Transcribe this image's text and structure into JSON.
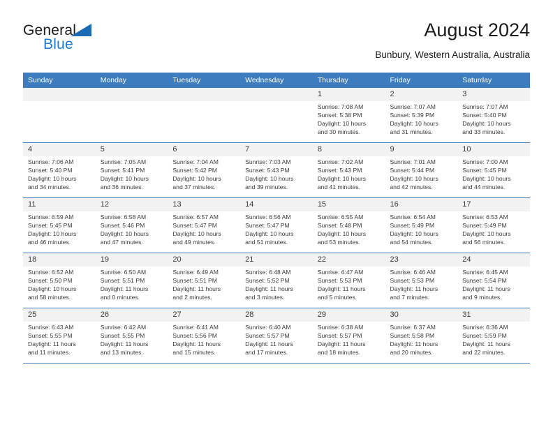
{
  "logo": {
    "word1": "General",
    "word2": "Blue",
    "triangle_color": "#1a6cb5",
    "blue_color": "#1a7cd0"
  },
  "header": {
    "title": "August 2024",
    "subtitle": "Bunbury, Western Australia, Australia",
    "header_bg": "#3c7cbf",
    "daynum_bg": "#f2f2f2"
  },
  "weekday_headers": [
    "Sunday",
    "Monday",
    "Tuesday",
    "Wednesday",
    "Thursday",
    "Friday",
    "Saturday"
  ],
  "labels": {
    "sunrise_prefix": "Sunrise:",
    "sunset_prefix": "Sunset:",
    "daylight_prefix": "Daylight:"
  },
  "weeks": [
    [
      {
        "day": "",
        "empty": true
      },
      {
        "day": "",
        "empty": true
      },
      {
        "day": "",
        "empty": true
      },
      {
        "day": "",
        "empty": true
      },
      {
        "day": "1",
        "sunrise": "Sunrise: 7:08 AM",
        "sunset": "Sunset: 5:38 PM",
        "daylight_l1": "Daylight: 10 hours",
        "daylight_l2": "and 30 minutes."
      },
      {
        "day": "2",
        "sunrise": "Sunrise: 7:07 AM",
        "sunset": "Sunset: 5:39 PM",
        "daylight_l1": "Daylight: 10 hours",
        "daylight_l2": "and 31 minutes."
      },
      {
        "day": "3",
        "sunrise": "Sunrise: 7:07 AM",
        "sunset": "Sunset: 5:40 PM",
        "daylight_l1": "Daylight: 10 hours",
        "daylight_l2": "and 33 minutes."
      }
    ],
    [
      {
        "day": "4",
        "sunrise": "Sunrise: 7:06 AM",
        "sunset": "Sunset: 5:40 PM",
        "daylight_l1": "Daylight: 10 hours",
        "daylight_l2": "and 34 minutes."
      },
      {
        "day": "5",
        "sunrise": "Sunrise: 7:05 AM",
        "sunset": "Sunset: 5:41 PM",
        "daylight_l1": "Daylight: 10 hours",
        "daylight_l2": "and 36 minutes."
      },
      {
        "day": "6",
        "sunrise": "Sunrise: 7:04 AM",
        "sunset": "Sunset: 5:42 PM",
        "daylight_l1": "Daylight: 10 hours",
        "daylight_l2": "and 37 minutes."
      },
      {
        "day": "7",
        "sunrise": "Sunrise: 7:03 AM",
        "sunset": "Sunset: 5:43 PM",
        "daylight_l1": "Daylight: 10 hours",
        "daylight_l2": "and 39 minutes."
      },
      {
        "day": "8",
        "sunrise": "Sunrise: 7:02 AM",
        "sunset": "Sunset: 5:43 PM",
        "daylight_l1": "Daylight: 10 hours",
        "daylight_l2": "and 41 minutes."
      },
      {
        "day": "9",
        "sunrise": "Sunrise: 7:01 AM",
        "sunset": "Sunset: 5:44 PM",
        "daylight_l1": "Daylight: 10 hours",
        "daylight_l2": "and 42 minutes."
      },
      {
        "day": "10",
        "sunrise": "Sunrise: 7:00 AM",
        "sunset": "Sunset: 5:45 PM",
        "daylight_l1": "Daylight: 10 hours",
        "daylight_l2": "and 44 minutes."
      }
    ],
    [
      {
        "day": "11",
        "sunrise": "Sunrise: 6:59 AM",
        "sunset": "Sunset: 5:45 PM",
        "daylight_l1": "Daylight: 10 hours",
        "daylight_l2": "and 46 minutes."
      },
      {
        "day": "12",
        "sunrise": "Sunrise: 6:58 AM",
        "sunset": "Sunset: 5:46 PM",
        "daylight_l1": "Daylight: 10 hours",
        "daylight_l2": "and 47 minutes."
      },
      {
        "day": "13",
        "sunrise": "Sunrise: 6:57 AM",
        "sunset": "Sunset: 5:47 PM",
        "daylight_l1": "Daylight: 10 hours",
        "daylight_l2": "and 49 minutes."
      },
      {
        "day": "14",
        "sunrise": "Sunrise: 6:56 AM",
        "sunset": "Sunset: 5:47 PM",
        "daylight_l1": "Daylight: 10 hours",
        "daylight_l2": "and 51 minutes."
      },
      {
        "day": "15",
        "sunrise": "Sunrise: 6:55 AM",
        "sunset": "Sunset: 5:48 PM",
        "daylight_l1": "Daylight: 10 hours",
        "daylight_l2": "and 53 minutes."
      },
      {
        "day": "16",
        "sunrise": "Sunrise: 6:54 AM",
        "sunset": "Sunset: 5:49 PM",
        "daylight_l1": "Daylight: 10 hours",
        "daylight_l2": "and 54 minutes."
      },
      {
        "day": "17",
        "sunrise": "Sunrise: 6:53 AM",
        "sunset": "Sunset: 5:49 PM",
        "daylight_l1": "Daylight: 10 hours",
        "daylight_l2": "and 56 minutes."
      }
    ],
    [
      {
        "day": "18",
        "sunrise": "Sunrise: 6:52 AM",
        "sunset": "Sunset: 5:50 PM",
        "daylight_l1": "Daylight: 10 hours",
        "daylight_l2": "and 58 minutes."
      },
      {
        "day": "19",
        "sunrise": "Sunrise: 6:50 AM",
        "sunset": "Sunset: 5:51 PM",
        "daylight_l1": "Daylight: 11 hours",
        "daylight_l2": "and 0 minutes."
      },
      {
        "day": "20",
        "sunrise": "Sunrise: 6:49 AM",
        "sunset": "Sunset: 5:51 PM",
        "daylight_l1": "Daylight: 11 hours",
        "daylight_l2": "and 2 minutes."
      },
      {
        "day": "21",
        "sunrise": "Sunrise: 6:48 AM",
        "sunset": "Sunset: 5:52 PM",
        "daylight_l1": "Daylight: 11 hours",
        "daylight_l2": "and 3 minutes."
      },
      {
        "day": "22",
        "sunrise": "Sunrise: 6:47 AM",
        "sunset": "Sunset: 5:53 PM",
        "daylight_l1": "Daylight: 11 hours",
        "daylight_l2": "and 5 minutes."
      },
      {
        "day": "23",
        "sunrise": "Sunrise: 6:46 AM",
        "sunset": "Sunset: 5:53 PM",
        "daylight_l1": "Daylight: 11 hours",
        "daylight_l2": "and 7 minutes."
      },
      {
        "day": "24",
        "sunrise": "Sunrise: 6:45 AM",
        "sunset": "Sunset: 5:54 PM",
        "daylight_l1": "Daylight: 11 hours",
        "daylight_l2": "and 9 minutes."
      }
    ],
    [
      {
        "day": "25",
        "sunrise": "Sunrise: 6:43 AM",
        "sunset": "Sunset: 5:55 PM",
        "daylight_l1": "Daylight: 11 hours",
        "daylight_l2": "and 11 minutes."
      },
      {
        "day": "26",
        "sunrise": "Sunrise: 6:42 AM",
        "sunset": "Sunset: 5:55 PM",
        "daylight_l1": "Daylight: 11 hours",
        "daylight_l2": "and 13 minutes."
      },
      {
        "day": "27",
        "sunrise": "Sunrise: 6:41 AM",
        "sunset": "Sunset: 5:56 PM",
        "daylight_l1": "Daylight: 11 hours",
        "daylight_l2": "and 15 minutes."
      },
      {
        "day": "28",
        "sunrise": "Sunrise: 6:40 AM",
        "sunset": "Sunset: 5:57 PM",
        "daylight_l1": "Daylight: 11 hours",
        "daylight_l2": "and 17 minutes."
      },
      {
        "day": "29",
        "sunrise": "Sunrise: 6:38 AM",
        "sunset": "Sunset: 5:57 PM",
        "daylight_l1": "Daylight: 11 hours",
        "daylight_l2": "and 18 minutes."
      },
      {
        "day": "30",
        "sunrise": "Sunrise: 6:37 AM",
        "sunset": "Sunset: 5:58 PM",
        "daylight_l1": "Daylight: 11 hours",
        "daylight_l2": "and 20 minutes."
      },
      {
        "day": "31",
        "sunrise": "Sunrise: 6:36 AM",
        "sunset": "Sunset: 5:59 PM",
        "daylight_l1": "Daylight: 11 hours",
        "daylight_l2": "and 22 minutes."
      }
    ]
  ]
}
